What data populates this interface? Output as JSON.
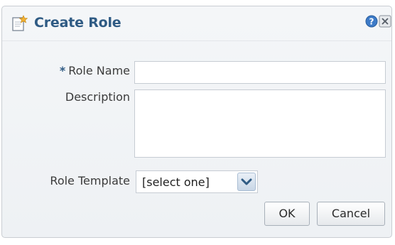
{
  "dialog": {
    "title": "Create Role",
    "title_icon": "new-document-icon",
    "help_icon": "help-icon",
    "close_icon": "close-icon"
  },
  "form": {
    "required_marker": "*",
    "role_name": {
      "label": "Role Name",
      "value": "",
      "required": true
    },
    "description": {
      "label": "Description",
      "value": ""
    },
    "role_template": {
      "label": "Role Template",
      "selected": "[select one]"
    }
  },
  "buttons": {
    "ok_label": "OK",
    "cancel_label": "Cancel"
  },
  "colors": {
    "title": "#2f5b84",
    "accent": "#f3b233"
  }
}
